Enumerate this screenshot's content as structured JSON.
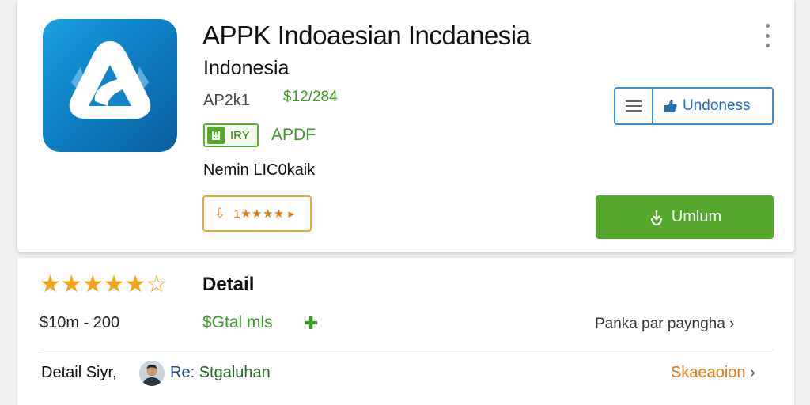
{
  "app": {
    "title": "APPK Indoaesian Incdanesia",
    "subtitle": "Indonesia",
    "version": "AP2k1",
    "price": "$12/284",
    "tag_label": "IRY",
    "category": "APDF",
    "developer": "Nemin LIC0kaik",
    "rating_chip": "1★★★★ ▸"
  },
  "actions": {
    "language_button": "Undoness",
    "install_button": "Umlum"
  },
  "details": {
    "stars": "★★★★★",
    "rating_fraction": 0.9,
    "heading": "Detail",
    "size_range": "$10m - 200",
    "total_label": "$Gtal mls",
    "permissions_link": "Panka par payngha",
    "store_label": "Detail Siyr,",
    "reviewer_prefix": "Re:",
    "reviewer_name": "Stgaluhan",
    "open_link": "Skaeaoion"
  },
  "colors": {
    "accent_green": "#55a82c",
    "accent_blue": "#3b8fd6",
    "accent_orange": "#f1a43a",
    "star": "#f4a31c"
  }
}
